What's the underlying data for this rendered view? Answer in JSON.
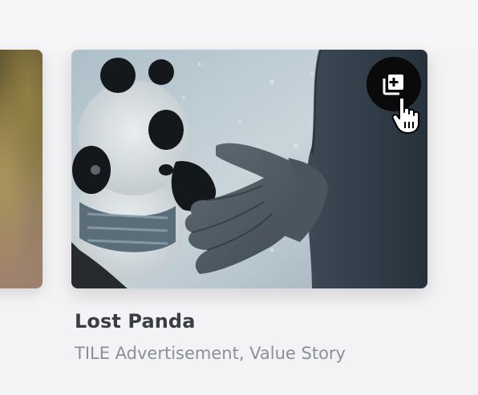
{
  "cards": [
    {
      "image_description": "",
      "visible": "partial"
    },
    {
      "title": "Lost Panda",
      "subtitle": "TILE Advertisement, Value Story",
      "add_to_collection_icon": "add-to-collection-icon"
    }
  ],
  "cursor": {
    "icon": "hand-pointer-icon"
  },
  "colors": {
    "background": "#f3f3f5",
    "title": "#3a3d42",
    "subtitle": "#8a9099",
    "button_bg": "#0a0a0a",
    "button_icon": "#ffffff"
  }
}
